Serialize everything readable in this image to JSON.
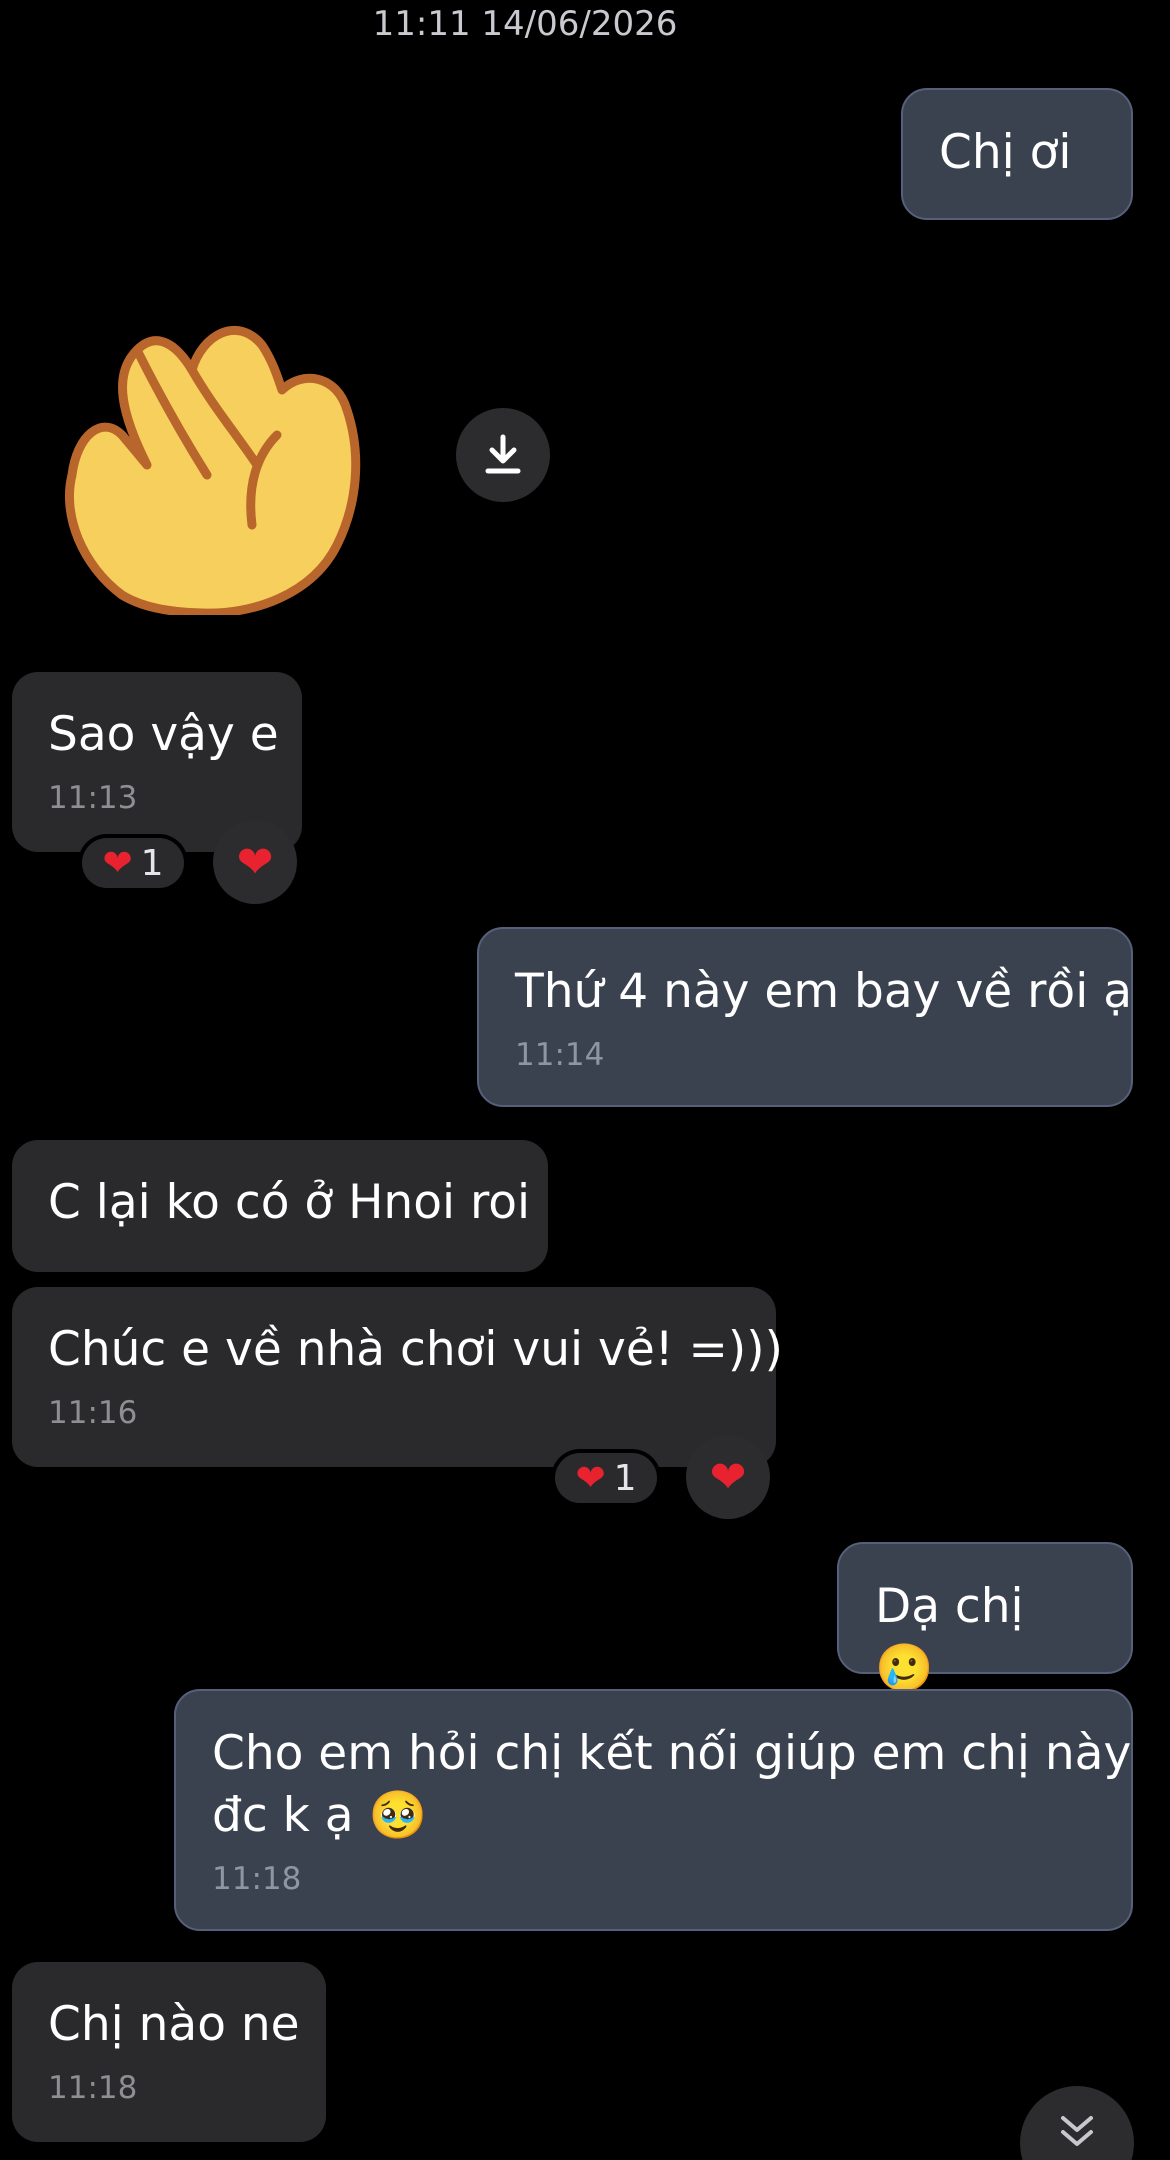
{
  "date_separator": "11:11 14/06/2026",
  "messages": [
    {
      "side": "sent",
      "text": "Chị ơi",
      "time": ""
    },
    {
      "side": "recv",
      "text": "Sao vậy e",
      "time": "11:13",
      "reaction_count": "1"
    },
    {
      "side": "sent",
      "text": "Thứ 4 này em bay về rồi ạ",
      "time": "11:14"
    },
    {
      "side": "recv",
      "text": "C lại ko có ở Hnoi roi",
      "time": ""
    },
    {
      "side": "recv",
      "text": "Chúc e về nhà chơi vui vẻ! =)))",
      "time": "11:16",
      "reaction_count": "1"
    },
    {
      "side": "sent",
      "text": "Dạ chị",
      "emoji": "🥲",
      "time": ""
    },
    {
      "side": "sent",
      "text_line1": "Cho em hỏi chị kết nối giúp em chị này",
      "text_line2": "đc k ạ",
      "emoji": "🥹",
      "time": "11:18"
    },
    {
      "side": "recv",
      "text": "Chị nào ne",
      "time": "11:18"
    }
  ],
  "icons": {
    "sticker": "waving-hand-sticker",
    "download": "download-icon",
    "reaction": "red-heart",
    "scroll": "double-chevron-down-icon"
  },
  "colors": {
    "background": "#000000",
    "sent_bubble": "#3a4250",
    "received_bubble": "#2a2a2c",
    "heart": "#e8232f"
  }
}
